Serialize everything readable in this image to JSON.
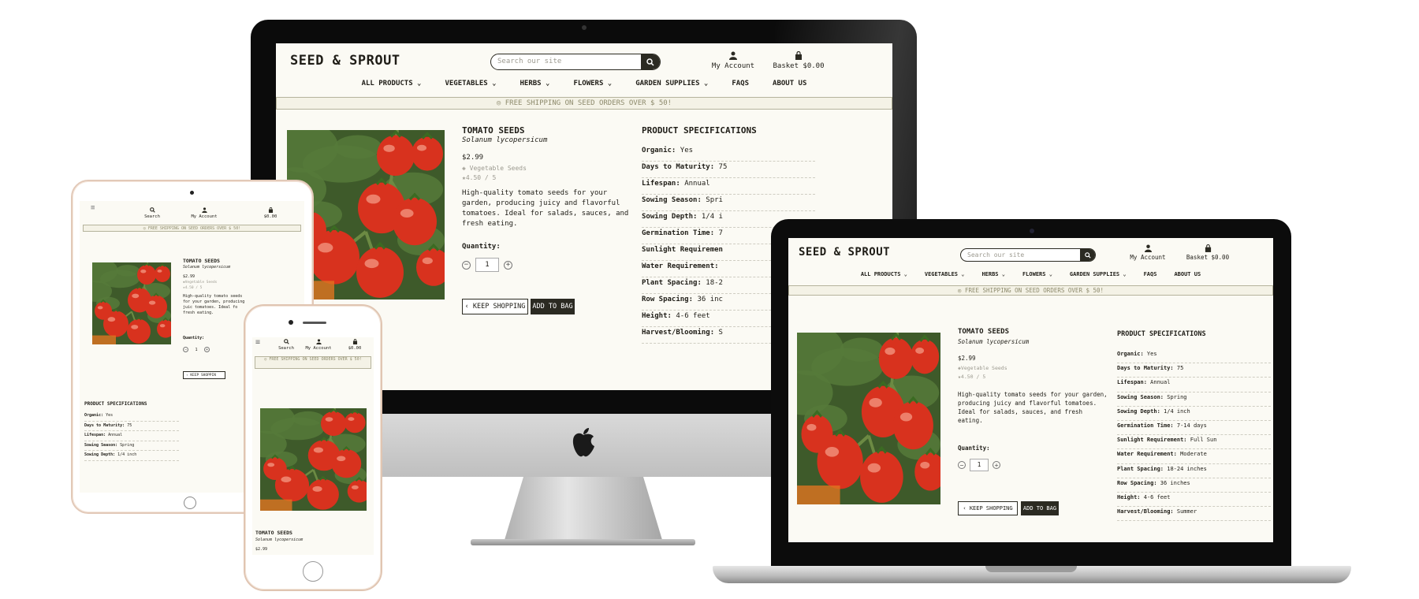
{
  "site": {
    "logo": "SEED & SPROUT",
    "search_placeholder": "Search our site",
    "account_label": "My Account",
    "basket_label": "Basket $0.00",
    "basket_short": "$0.00",
    "search_label": "Search",
    "nav": [
      {
        "label": "ALL PRODUCTS",
        "has_dropdown": true
      },
      {
        "label": "VEGETABLES",
        "has_dropdown": true
      },
      {
        "label": "HERBS",
        "has_dropdown": true
      },
      {
        "label": "FLOWERS",
        "has_dropdown": true
      },
      {
        "label": "GARDEN SUPPLIES",
        "has_dropdown": true
      },
      {
        "label": "FAQS",
        "has_dropdown": false
      },
      {
        "label": "ABOUT US",
        "has_dropdown": false
      }
    ],
    "banner": "FREE SHIPPING ON SEED ORDERS OVER $ 50!",
    "banner_short": "FREE SHIPPING ON SEED ORDERS OVER $ 50!"
  },
  "product": {
    "name": "TOMATO SEEDS",
    "latin": "Solanum lycopersicum",
    "price": "$2.99",
    "category": "Vegetable Seeds",
    "rating": "4.50 / 5",
    "description": "High-quality tomato seeds for your garden, producing juicy and flavorful tomatoes. Ideal for salads, sauces, and fresh eating.",
    "quantity_label": "Quantity:",
    "quantity_value": "1",
    "keep_shopping": "KEEP SHOPPING",
    "add_to_bag": "ADD TO BAG"
  },
  "specs": {
    "title": "PRODUCT SPECIFICATIONS",
    "rows": [
      {
        "label": "Organic:",
        "value": "Yes"
      },
      {
        "label": "Days to Maturity:",
        "value": "75"
      },
      {
        "label": "Lifespan:",
        "value": "Annual"
      },
      {
        "label": "Sowing Season:",
        "value": "Spring"
      },
      {
        "label": "Sowing Depth:",
        "value": "1/4 inch"
      },
      {
        "label": "Germination Time:",
        "value": "7-14 days"
      },
      {
        "label": "Sunlight Requirement:",
        "value": "Full Sun"
      },
      {
        "label": "Water Requirement:",
        "value": "Moderate"
      },
      {
        "label": "Plant Spacing:",
        "value": "18-24 inches"
      },
      {
        "label": "Row Spacing:",
        "value": "36 inches"
      },
      {
        "label": "Height:",
        "value": "4-6 feet"
      },
      {
        "label": "Harvest/Blooming:",
        "value": "Summer"
      }
    ]
  },
  "imac_specs_visible": [
    {
      "label": "Organic:",
      "value": "Yes"
    },
    {
      "label": "Days to Maturity:",
      "value": "75"
    },
    {
      "label": "Lifespan:",
      "value": "Annual"
    },
    {
      "label": "Sowing Season:",
      "value": "Spri"
    },
    {
      "label": "Sowing Depth:",
      "value": "1/4 i"
    },
    {
      "label": "Germination Time:",
      "value": "7"
    },
    {
      "label": "Sunlight Requiremen",
      "value": ""
    },
    {
      "label": "Water Requirement:",
      "value": ""
    },
    {
      "label": "Plant Spacing:",
      "value": "18-2"
    },
    {
      "label": "Row Spacing:",
      "value": "36 inc"
    },
    {
      "label": "Height:",
      "value": "4-6 feet"
    },
    {
      "label": "Harvest/Blooming:",
      "value": "S"
    }
  ],
  "tablet_specs_visible": [
    {
      "label": "Organic:",
      "value": "Yes"
    },
    {
      "label": "Days to Maturity:",
      "value": "75"
    },
    {
      "label": "Lifespan:",
      "value": "Annual"
    },
    {
      "label": "Sowing Season:",
      "value": "Spring"
    },
    {
      "label": "Sowing Depth:",
      "value": "1/4 inch"
    }
  ],
  "tablet_description_visible": "High-quality tomato seeds for your garden, producing juic tomatoes. Ideal fo fresh eating.",
  "tablet_keep_shopping": "KEEP SHOPPIN",
  "colors": {
    "accent": "#2b2a22",
    "background": "#fbfaf4",
    "banner_text": "#8d8a6c"
  },
  "icons": {
    "search": "search-icon",
    "account": "user-icon",
    "basket": "bag-icon",
    "menu": "hamburger-icon",
    "tag": "tag-icon",
    "star": "star-icon"
  }
}
